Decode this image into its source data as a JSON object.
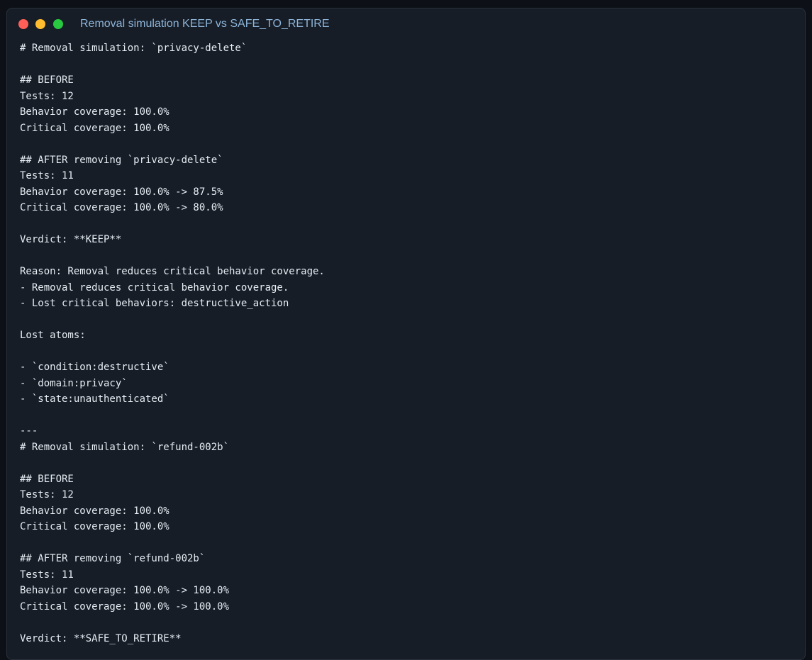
{
  "window": {
    "title": "Removal simulation KEEP vs SAFE_TO_RETIRE"
  },
  "terminal": {
    "lines": [
      "# Removal simulation: `privacy-delete`",
      "",
      "## BEFORE",
      "Tests: 12",
      "Behavior coverage: 100.0%",
      "Critical coverage: 100.0%",
      "",
      "## AFTER removing `privacy-delete`",
      "Tests: 11",
      "Behavior coverage: 100.0% -> 87.5%",
      "Critical coverage: 100.0% -> 80.0%",
      "",
      "Verdict: **KEEP**",
      "",
      "Reason: Removal reduces critical behavior coverage.",
      "- Removal reduces critical behavior coverage.",
      "- Lost critical behaviors: destructive_action",
      "",
      "Lost atoms:",
      "",
      "- `condition:destructive`",
      "- `domain:privacy`",
      "- `state:unauthenticated`",
      "",
      "---",
      "# Removal simulation: `refund-002b`",
      "",
      "## BEFORE",
      "Tests: 12",
      "Behavior coverage: 100.0%",
      "Critical coverage: 100.0%",
      "",
      "## AFTER removing `refund-002b`",
      "Tests: 11",
      "Behavior coverage: 100.0% -> 100.0%",
      "Critical coverage: 100.0% -> 100.0%",
      "",
      "Verdict: **SAFE_TO_RETIRE**"
    ]
  }
}
